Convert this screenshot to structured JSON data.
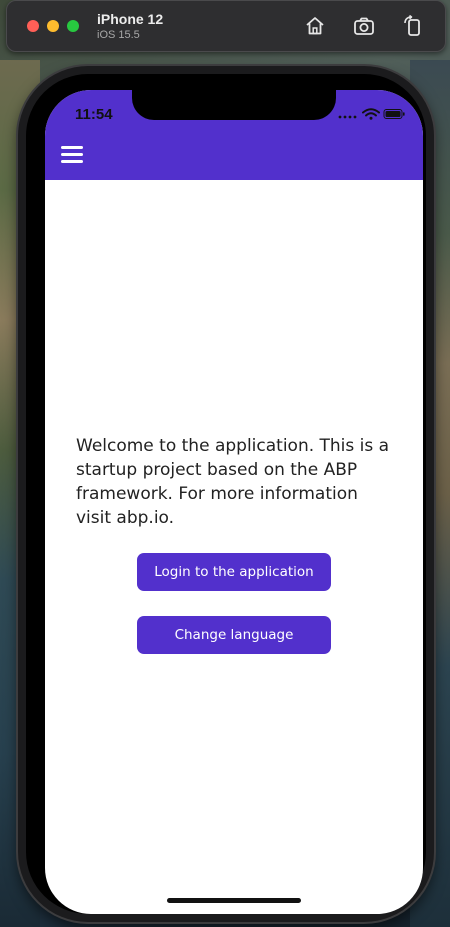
{
  "simulator": {
    "device_name": "iPhone 12",
    "os_version": "iOS 15.5",
    "icons": [
      "home-icon",
      "screenshot-icon",
      "rotate-icon"
    ]
  },
  "status_bar": {
    "time": "11:54",
    "icons": [
      "cellular-icon",
      "wifi-icon",
      "battery-icon"
    ]
  },
  "header": {
    "background_color": "#5230cc",
    "menu_icon": "hamburger-menu-icon"
  },
  "main": {
    "welcome_text": "Welcome to the application. This is a startup project based on the ABP framework. For more information visit abp.io.",
    "login_button_label": "Login to the application",
    "change_language_button_label": "Change language",
    "button_color": "#5230cc"
  }
}
